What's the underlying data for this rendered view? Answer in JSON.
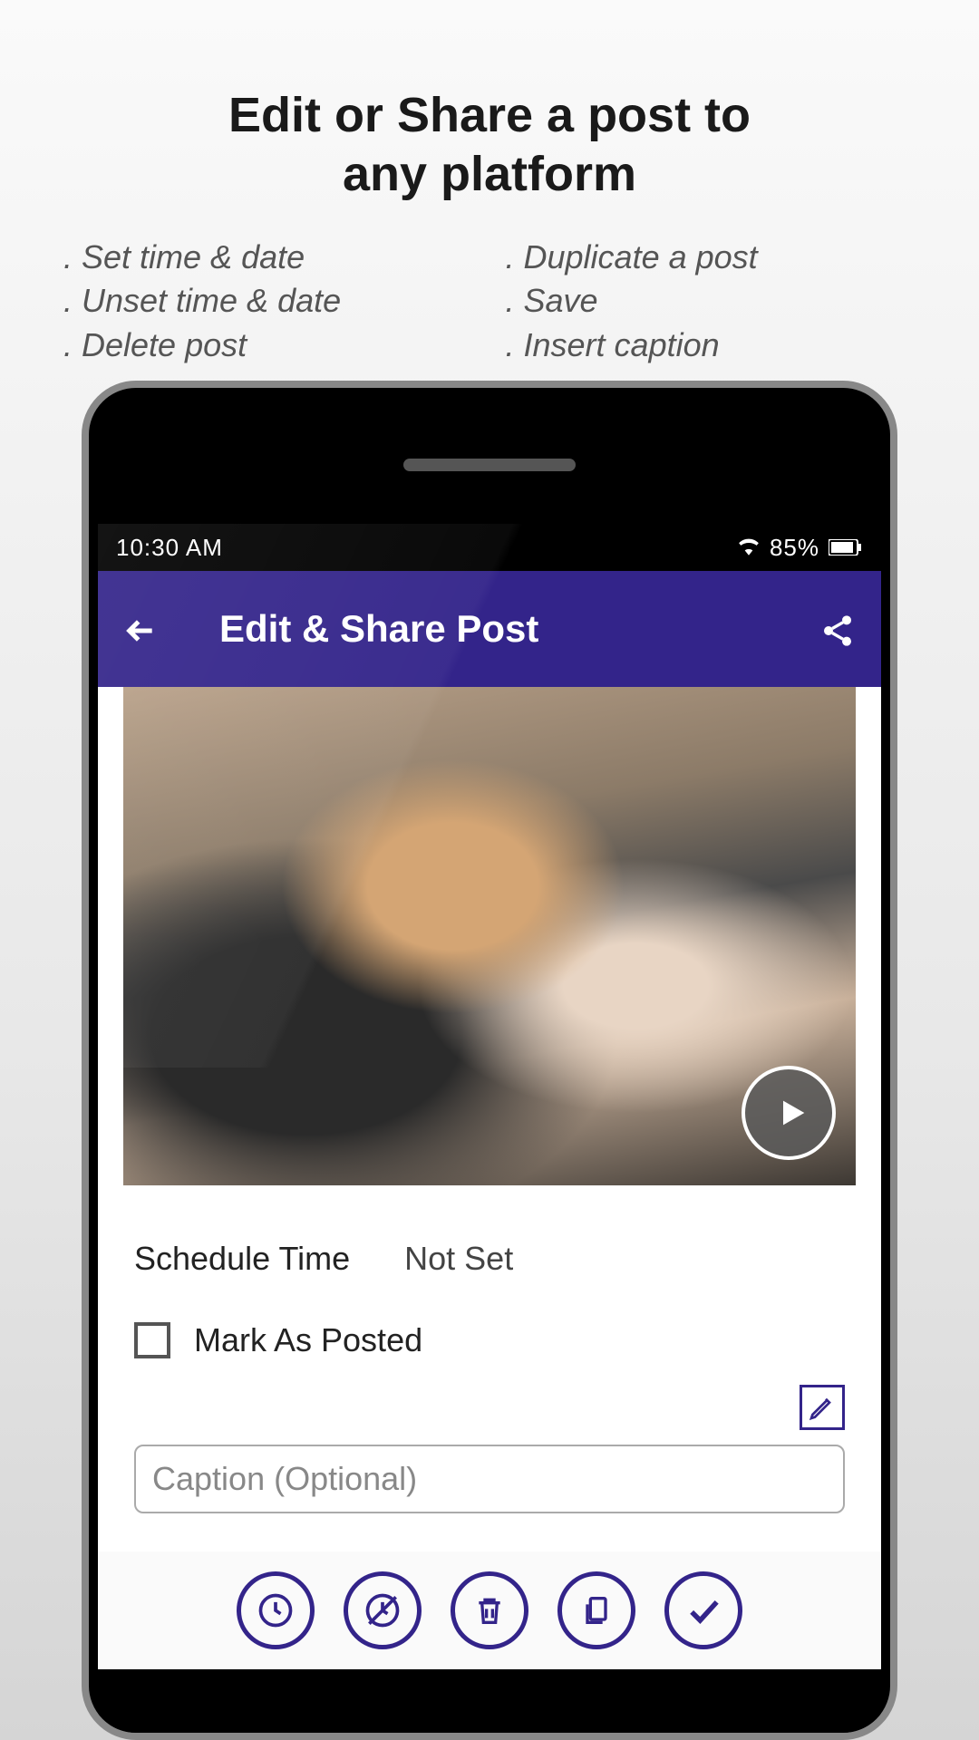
{
  "promo": {
    "title_line1": "Edit or Share a post to",
    "title_line2": "any platform",
    "features_left": [
      ". Set time & date",
      ". Unset time & date",
      ". Delete post"
    ],
    "features_right": [
      ". Duplicate a post",
      ". Save",
      ". Insert caption"
    ]
  },
  "status_bar": {
    "time": "10:30 AM",
    "battery_percent": "85%"
  },
  "header": {
    "title": "Edit & Share Post"
  },
  "content": {
    "schedule_label": "Schedule Time",
    "schedule_value": "Not Set",
    "mark_posted_label": "Mark As Posted",
    "caption_placeholder": "Caption (Optional)"
  },
  "toolbar": {
    "icons": [
      "clock-icon",
      "clock-off-icon",
      "trash-icon",
      "duplicate-icon",
      "check-icon"
    ]
  }
}
